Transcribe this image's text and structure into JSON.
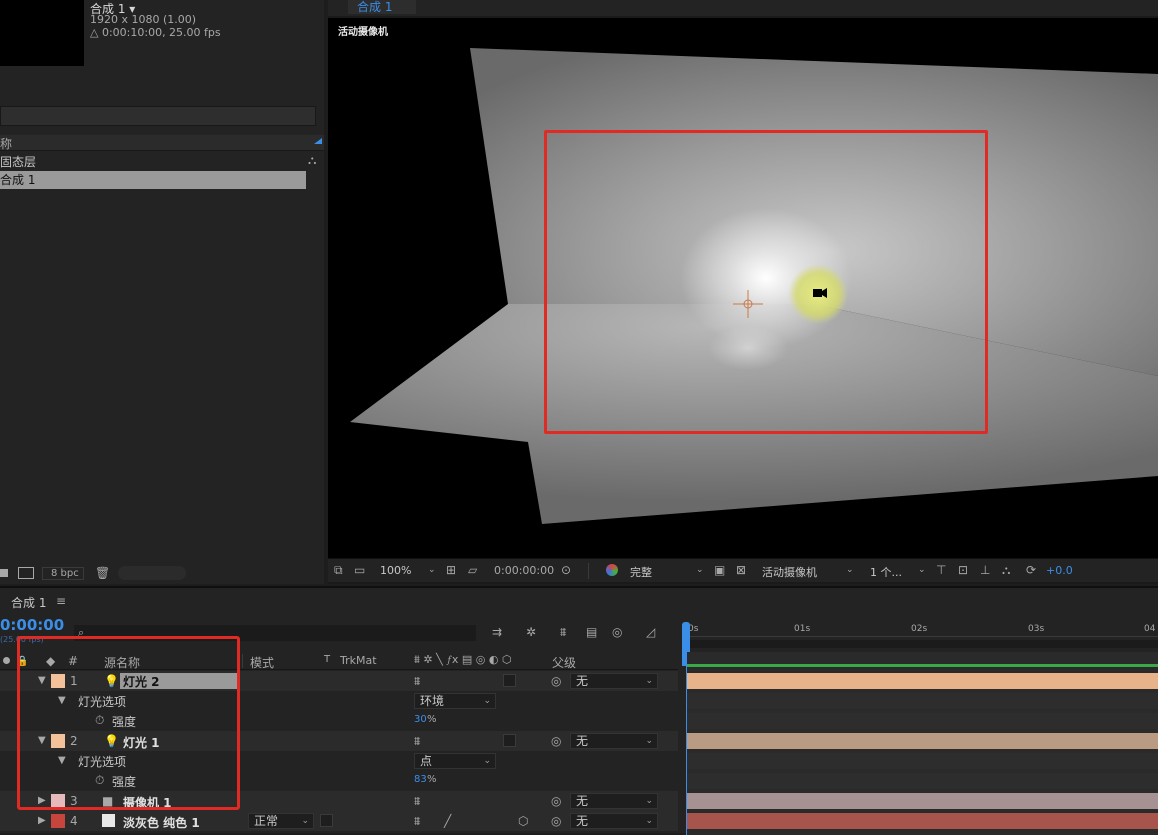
{
  "project": {
    "comp_name": "合成 1 ▾",
    "comp_resolution": "1920 x 1080 (1.00)",
    "comp_duration": "△ 0:00:10:00, 25.00 fps",
    "column_header": "称",
    "items": [
      {
        "label": "固态层"
      },
      {
        "label": "合成 1"
      }
    ],
    "bpc": "8 bpc"
  },
  "viewer": {
    "tab_label": "合成 1",
    "camera_label": "活动摄像机",
    "toolbar": {
      "zoom": "100%",
      "timecode": "0:00:00:00",
      "resolution": "完整",
      "view": "活动摄像机",
      "views_count": "1 个...",
      "exposure": "+0.0"
    }
  },
  "timeline": {
    "tab_label": "合成 1",
    "menu_icon": "≡",
    "current_time": "0:00:00",
    "fps_hint": "(25.00 fps)",
    "search_icon": "⌕",
    "headers": {
      "number": "#",
      "source_name": "源名称",
      "mode": "模式",
      "t": "T",
      "trkmat": "TrkMat",
      "parent": "父级"
    },
    "ruler_ticks": [
      "0s",
      "01s",
      "02s",
      "03s",
      "04"
    ],
    "rows": [
      {
        "kind": "layer",
        "num": "1",
        "name": "灯光 2",
        "swatch": "#f3c29a",
        "icon": "light-icon",
        "parent": "无",
        "selected": true
      },
      {
        "kind": "group",
        "name": "灯光选项",
        "value": "环境"
      },
      {
        "kind": "prop",
        "name": "强度",
        "value": "30",
        "unit": "%"
      },
      {
        "kind": "layer",
        "num": "2",
        "name": "灯光 1",
        "swatch": "#f3c29a",
        "icon": "light-icon",
        "parent": "无"
      },
      {
        "kind": "group",
        "name": "灯光选项",
        "value": "点"
      },
      {
        "kind": "prop",
        "name": "强度",
        "value": "83",
        "unit": "%"
      },
      {
        "kind": "layer",
        "num": "3",
        "name": "摄像机 1",
        "swatch": "#e6b9bb",
        "icon": "camera-icon",
        "parent": "无"
      },
      {
        "kind": "layer",
        "num": "4",
        "name": "淡灰色 纯色 1",
        "swatch": "#c6453c",
        "icon": "solid-icon",
        "mode": "正常",
        "parent": "无"
      }
    ],
    "bar_colors": [
      "#e6b38a",
      "#2d2d2d",
      "#2d2d2d",
      "#b99b83",
      "#2d2d2d",
      "#2d2d2d",
      "#a79293",
      "#a7544d"
    ]
  }
}
